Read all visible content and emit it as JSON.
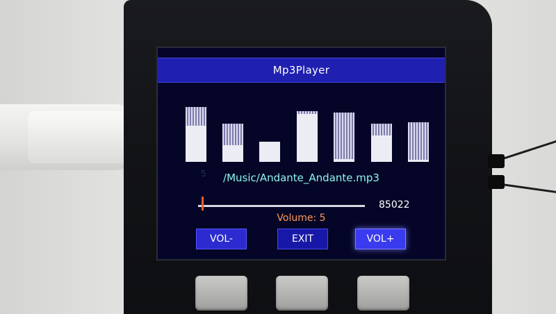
{
  "app": {
    "title": "Mp3Player"
  },
  "spectrum": {
    "bars": [
      {
        "level": 0.94,
        "solid": 0.62
      },
      {
        "level": 0.65,
        "solid": 0.28
      },
      {
        "level": 0.34,
        "solid": 0.34
      },
      {
        "level": 0.87,
        "solid": 0.82
      },
      {
        "level": 0.85,
        "solid": 0.05
      },
      {
        "level": 0.65,
        "solid": 0.45
      },
      {
        "level": 0.68,
        "solid": 0.04
      }
    ]
  },
  "track": {
    "index": "5",
    "filename": "/Music/Andante_Andante.mp3",
    "position": "85022",
    "progress": 0.02
  },
  "volume": {
    "text": "Volume: 5"
  },
  "buttons": {
    "vol_down": "VOL-",
    "exit": "EXIT",
    "vol_up": "VOL+"
  },
  "colors": {
    "screen_bg": "#050627",
    "title_bar": "#1f1fb0",
    "filename": "#8ef5ef",
    "volume_text": "#ff9a52",
    "progress_thumb": "#ff5a2a",
    "button_blue": "#2b2bd0"
  }
}
